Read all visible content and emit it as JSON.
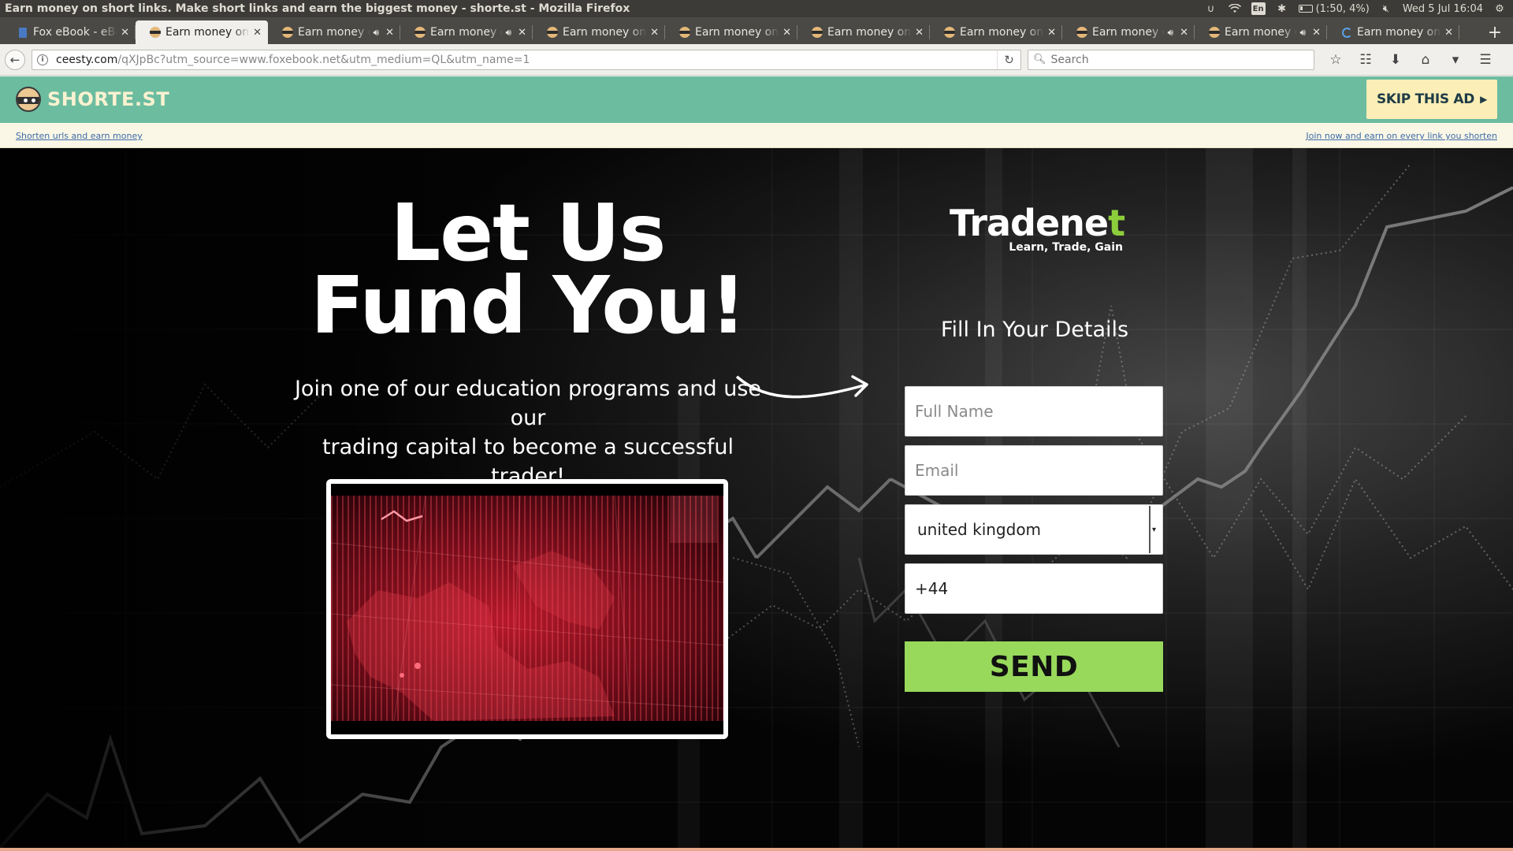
{
  "os": {
    "window_title": "Earn money on short links. Make short links and earn the biggest money - shorte.st - Mozilla Firefox",
    "battery": "(1:50, 4%)",
    "keyboard": "En",
    "clock": "Wed  5 Jul 16:04"
  },
  "tabs": [
    {
      "label": "Fox eBook - eBo",
      "favicon": "book-icon",
      "audio": false,
      "active": false
    },
    {
      "label": "Earn money on s",
      "favicon": "shortest-icon",
      "audio": false,
      "active": true
    },
    {
      "label": "Earn money c",
      "favicon": "shortest-icon",
      "audio": true,
      "active": false
    },
    {
      "label": "Earn money c",
      "favicon": "shortest-icon",
      "audio": true,
      "active": false
    },
    {
      "label": "Earn money on s",
      "favicon": "shortest-icon",
      "audio": false,
      "active": false
    },
    {
      "label": "Earn money on s",
      "favicon": "shortest-icon",
      "audio": false,
      "active": false
    },
    {
      "label": "Earn money on s",
      "favicon": "shortest-icon",
      "audio": false,
      "active": false
    },
    {
      "label": "Earn money on s",
      "favicon": "shortest-icon",
      "audio": false,
      "active": false
    },
    {
      "label": "Earn money c",
      "favicon": "shortest-icon",
      "audio": true,
      "active": false
    },
    {
      "label": "Earn money c",
      "favicon": "shortest-icon",
      "audio": true,
      "active": false
    },
    {
      "label": "Earn money on s",
      "favicon": "loading-icon",
      "audio": false,
      "active": false
    }
  ],
  "nav": {
    "url_host": "ceesty.com",
    "url_path": "/qXJpBc?utm_source=www.foxebook.net&utm_medium=QL&utm_name=1",
    "search_placeholder": "Search"
  },
  "shortest": {
    "logo_text": "SHORTE.ST",
    "skip_label": "SKIP THIS AD",
    "left_link": "Shorten urls and earn money",
    "right_link": "Join now and earn on every link you shorten",
    "bar_color": "#6cbca0",
    "skip_color": "#fbeeb6"
  },
  "ad": {
    "headline_line1": "Let Us",
    "headline_line2": "Fund You!",
    "subline_line1": "Join one of our education programs and use",
    "subline_line2": "our",
    "subline_line3": "trading capital to become a successful trader!",
    "brand_name": "Tradene",
    "brand_plus": "t",
    "brand_tagline": "Learn, Trade, Gain",
    "form_title": "Fill In Your Details",
    "name_placeholder": "Full Name",
    "email_placeholder": "Email",
    "country_value": "united kingdom",
    "phone_value": "+44",
    "send_label": "SEND",
    "send_color": "#98d95c",
    "brand_accent": "#8dce3c"
  }
}
